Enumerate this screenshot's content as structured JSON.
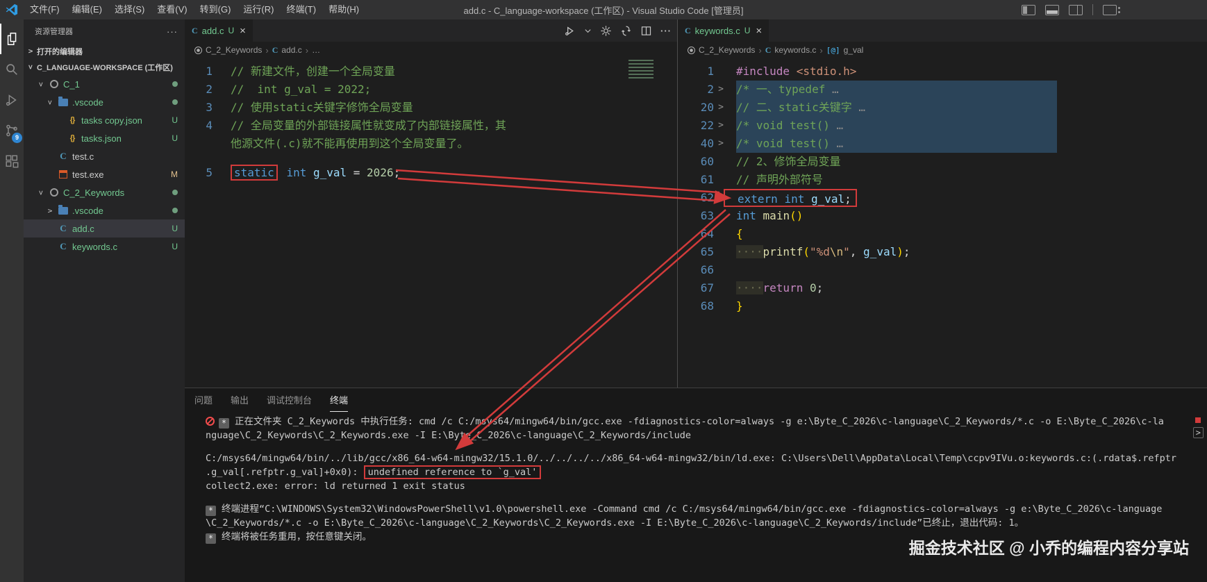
{
  "window": {
    "title": "add.c - C_language-workspace (工作区) - Visual Studio Code [管理员]",
    "menus": [
      "文件(F)",
      "编辑(E)",
      "选择(S)",
      "查看(V)",
      "转到(G)",
      "运行(R)",
      "终端(T)",
      "帮助(H)"
    ],
    "layout_icons": [
      "toggle-primary-sidebar",
      "toggle-panel",
      "toggle-secondary-sidebar",
      "customize-layout"
    ]
  },
  "activity_bar": {
    "items": [
      {
        "name": "explorer",
        "active": true
      },
      {
        "name": "search",
        "active": false
      },
      {
        "name": "run-debug",
        "active": false
      },
      {
        "name": "source-control",
        "active": false,
        "badge": "9"
      },
      {
        "name": "extensions",
        "active": false
      }
    ],
    "scm_badge": "9"
  },
  "sidebar": {
    "title": "资源管理器",
    "more": "···",
    "open_editors": "打开的编辑器",
    "workspace": "C_LANGUAGE-WORKSPACE (工作区)",
    "tree": [
      {
        "indent": 1,
        "chev": "open",
        "icon": "circle",
        "label": "C_1",
        "cls": "green",
        "dot": true
      },
      {
        "indent": 2,
        "chev": "open",
        "icon": "folder",
        "label": ".vscode",
        "cls": "green",
        "dot": true
      },
      {
        "indent": 3,
        "chev": "",
        "icon": "json",
        "label": "tasks copy.json",
        "cls": "green",
        "badge": "U"
      },
      {
        "indent": 3,
        "chev": "",
        "icon": "json",
        "label": "tasks.json",
        "cls": "green",
        "badge": "U"
      },
      {
        "indent": 2,
        "chev": "",
        "icon": "c",
        "label": "test.c",
        "cls": "plain"
      },
      {
        "indent": 2,
        "chev": "",
        "icon": "exe",
        "label": "test.exe",
        "cls": "plain",
        "badge": "M"
      },
      {
        "indent": 1,
        "chev": "open",
        "icon": "circle",
        "label": "C_2_Keywords",
        "cls": "green",
        "dot": true
      },
      {
        "indent": 2,
        "chev": "closed",
        "icon": "folder",
        "label": ".vscode",
        "cls": "green",
        "dot": true
      },
      {
        "indent": 2,
        "chev": "",
        "icon": "c",
        "label": "add.c",
        "cls": "green",
        "badge": "U",
        "selected": true
      },
      {
        "indent": 2,
        "chev": "",
        "icon": "c",
        "label": "keywords.c",
        "cls": "green",
        "badge": "U"
      }
    ]
  },
  "editors": {
    "left": {
      "tab": {
        "label": "add.c",
        "dirty": "U",
        "close": "×"
      },
      "breadcrumbs": [
        {
          "icon": "module",
          "label": "C_2_Keywords"
        },
        {
          "icon": "c-file",
          "label": "add.c"
        },
        {
          "icon": "",
          "label": "…"
        }
      ],
      "lines": [
        {
          "num": "1",
          "tokens": [
            {
              "c": "cm",
              "t": "// 新建文件，创建一个全局变量"
            }
          ]
        },
        {
          "num": "2",
          "tokens": [
            {
              "c": "cm",
              "t": "//  int g_val = 2022;"
            }
          ]
        },
        {
          "num": "3",
          "tokens": [
            {
              "c": "cm",
              "t": "// 使用static关键字修饰全局变量"
            }
          ]
        },
        {
          "num": "4",
          "tokens": [
            {
              "c": "cm",
              "t": "// 全局变量的外部链接属性就变成了内部链接属性，其"
            }
          ]
        },
        {
          "num": "",
          "tokens": [
            {
              "c": "cm",
              "t": "他源文件(.c)就不能再使用到这个全局变量了。"
            }
          ]
        },
        {
          "num": "5",
          "gap": true,
          "tokens": [
            {
              "c": "kw",
              "t": "static",
              "box": true
            },
            {
              "c": "tx",
              "t": " "
            },
            {
              "c": "kw",
              "t": "int"
            },
            {
              "c": "var",
              "t": " g_val "
            },
            {
              "c": "tx",
              "t": "= "
            },
            {
              "c": "num",
              "t": "2026"
            },
            {
              "c": "tx",
              "t": ";"
            }
          ]
        }
      ]
    },
    "right": {
      "tab": {
        "label": "keywords.c",
        "dirty": "U",
        "close": "×"
      },
      "breadcrumbs": [
        {
          "icon": "module",
          "label": "C_2_Keywords"
        },
        {
          "icon": "c-file",
          "label": "keywords.c"
        },
        {
          "icon": "symbol",
          "label": "g_val"
        }
      ],
      "lines": [
        {
          "num": "1",
          "tokens": [
            {
              "c": "pp",
              "t": "#include"
            },
            {
              "c": "tx",
              "t": " "
            },
            {
              "c": "str",
              "t": "<stdio.h>"
            }
          ]
        },
        {
          "num": "2",
          "fold": true,
          "hl": true,
          "tokens": [
            {
              "c": "cm",
              "t": "/* 一、typedef"
            },
            {
              "c": "ell",
              "t": " …"
            }
          ]
        },
        {
          "num": "20",
          "fold": true,
          "hl": true,
          "tokens": [
            {
              "c": "cm",
              "t": "// 二、static关键字"
            },
            {
              "c": "ell",
              "t": " …"
            }
          ]
        },
        {
          "num": "22",
          "fold": true,
          "hl": true,
          "tokens": [
            {
              "c": "cm",
              "t": "/* void test()"
            },
            {
              "c": "ell",
              "t": " …"
            }
          ]
        },
        {
          "num": "40",
          "fold": true,
          "hl": true,
          "tokens": [
            {
              "c": "cm",
              "t": "/* void test()"
            },
            {
              "c": "ell",
              "t": " …"
            }
          ]
        },
        {
          "num": "60",
          "tokens": [
            {
              "c": "cm",
              "t": "// 2、修饰全局变量"
            }
          ]
        },
        {
          "num": "61",
          "tokens": [
            {
              "c": "cm",
              "t": "// 声明外部符号"
            }
          ]
        },
        {
          "num": "62",
          "boxed": true,
          "tokens": [
            {
              "c": "kw",
              "t": "extern"
            },
            {
              "c": "tx",
              "t": " "
            },
            {
              "c": "kw",
              "t": "int"
            },
            {
              "c": "var",
              "t": " g_val"
            },
            {
              "c": "tx",
              "t": ";"
            }
          ]
        },
        {
          "num": "63",
          "tokens": [
            {
              "c": "kw",
              "t": "int"
            },
            {
              "c": "tx",
              "t": " "
            },
            {
              "c": "fn",
              "t": "main"
            },
            {
              "c": "pn",
              "t": "()"
            }
          ]
        },
        {
          "num": "64",
          "tokens": [
            {
              "c": "pn",
              "t": "{"
            }
          ]
        },
        {
          "num": "65",
          "tokens": [
            {
              "c": "ws",
              "t": "····"
            },
            {
              "c": "fn",
              "t": "printf"
            },
            {
              "c": "pn",
              "t": "("
            },
            {
              "c": "str",
              "t": "\"%d"
            },
            {
              "c": "esc",
              "t": "\\n"
            },
            {
              "c": "str",
              "t": "\""
            },
            {
              "c": "tx",
              "t": ", "
            },
            {
              "c": "var",
              "t": "g_val"
            },
            {
              "c": "pn",
              "t": ")"
            },
            {
              "c": "tx",
              "t": ";"
            }
          ]
        },
        {
          "num": "66",
          "tokens": []
        },
        {
          "num": "67",
          "tokens": [
            {
              "c": "ws",
              "t": "····"
            },
            {
              "c": "ctl",
              "t": "return"
            },
            {
              "c": "tx",
              "t": " "
            },
            {
              "c": "num",
              "t": "0"
            },
            {
              "c": "tx",
              "t": ";"
            }
          ]
        },
        {
          "num": "68",
          "tokens": [
            {
              "c": "pn",
              "t": "}"
            }
          ]
        }
      ]
    }
  },
  "panel": {
    "tabs": [
      "问题",
      "输出",
      "调试控制台",
      "终端"
    ],
    "active_tab": "终端",
    "terminal": [
      {
        "prefix": [
          "error",
          "star"
        ],
        "text": "正在文件夹 C_2_Keywords 中执行任务: cmd /c C:/msys64/mingw64/bin/gcc.exe -fdiagnostics-color=always -g e:\\Byte_C_2026\\c-language\\C_2_Keywords/*.c -o E:\\Byte_C_2026\\c-la"
      },
      {
        "text": "nguage\\C_2_Keywords\\C_2_Keywords.exe -I E:\\Byte_C_2026\\c-language\\C_2_Keywords/include"
      },
      {
        "gap": true,
        "text": "C:/msys64/mingw64/bin/../lib/gcc/x86_64-w64-mingw32/15.1.0/../../../../x86_64-w64-mingw32/bin/ld.exe: C:\\Users\\Dell\\AppData\\Local\\Temp\\ccpv9IVu.o:keywords.c:(.rdata$.refptr"
      },
      {
        "segments": [
          {
            "t": ".g_val[.refptr.g_val]+0x0): "
          },
          {
            "t": "undefined reference to `g_val'",
            "box": true
          }
        ]
      },
      {
        "text": "collect2.exe: error: ld returned 1 exit status"
      },
      {
        "gap": true,
        "prefix": [
          "star"
        ],
        "text": "终端进程“C:\\WINDOWS\\System32\\WindowsPowerShell\\v1.0\\powershell.exe -Command cmd /c C:/msys64/mingw64/bin/gcc.exe -fdiagnostics-color=always -g e:\\Byte_C_2026\\c-language"
      },
      {
        "text": "\\C_2_Keywords/*.c -o E:\\Byte_C_2026\\c-language\\C_2_Keywords\\C_2_Keywords.exe -I E:\\Byte_C_2026\\c-language\\C_2_Keywords/include”已终止，退出代码: 1。"
      },
      {
        "prefix": [
          "star"
        ],
        "text": "终端将被任务重用，按任意键关闭。"
      }
    ]
  },
  "watermark": "掘金技术社区 @ 小乔的编程内容分享站",
  "colors": {
    "annotation_red": "#d23b3b",
    "git_untracked_green": "#73c991",
    "git_modified_orange": "#e2c08d",
    "scm_badge_blue": "#2f86d2"
  }
}
